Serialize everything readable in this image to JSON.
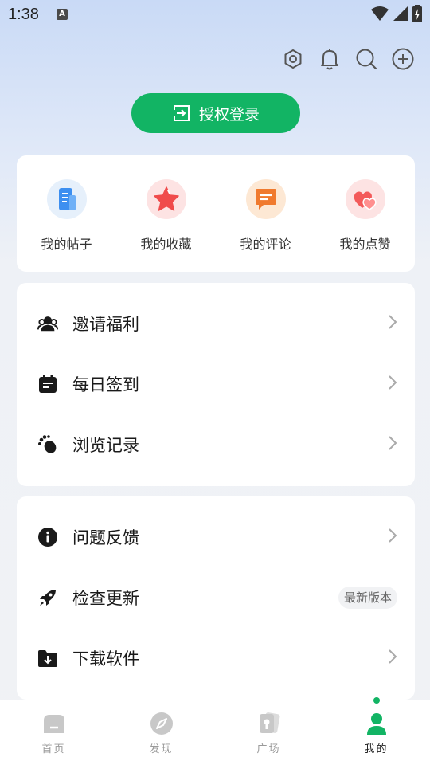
{
  "status_bar": {
    "time": "1:38",
    "app_icon_letter": "A"
  },
  "header": {
    "icons": [
      "settings-icon",
      "bell-icon",
      "search-icon",
      "add-circle-icon"
    ],
    "login_button": {
      "label": "授权登录",
      "icon": "login-icon",
      "color": "#12b464"
    }
  },
  "shortcuts": [
    {
      "label": "我的帖子",
      "icon": "document-icon"
    },
    {
      "label": "我的收藏",
      "icon": "star-icon"
    },
    {
      "label": "我的评论",
      "icon": "comment-icon"
    },
    {
      "label": "我的点赞",
      "icon": "hearts-icon"
    }
  ],
  "menu_group_1": [
    {
      "label": "邀请福利",
      "icon": "invite-users-icon"
    },
    {
      "label": "每日签到",
      "icon": "calendar-icon"
    },
    {
      "label": "浏览记录",
      "icon": "footprint-icon"
    }
  ],
  "menu_group_2": [
    {
      "label": "问题反馈",
      "icon": "info-icon"
    },
    {
      "label": "检查更新",
      "icon": "rocket-icon",
      "badge": "最新版本"
    },
    {
      "label": "下载软件",
      "icon": "download-folder-icon"
    }
  ],
  "bottom_nav": [
    {
      "label": "首页",
      "icon": "home-icon",
      "active": false
    },
    {
      "label": "发现",
      "icon": "compass-icon",
      "active": false
    },
    {
      "label": "广场",
      "icon": "square-icon",
      "active": false
    },
    {
      "label": "我的",
      "icon": "profile-icon",
      "active": true
    }
  ],
  "colors": {
    "accent": "#12b464",
    "nav_inactive": "#c8c8c8"
  }
}
